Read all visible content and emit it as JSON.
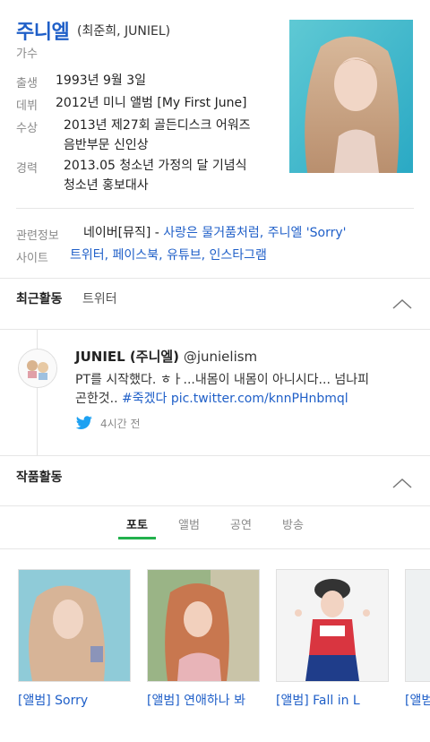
{
  "profile": {
    "name": "주니엘",
    "name_sub": "(최준희, JUNIEL)",
    "occupation": "가수",
    "rows": [
      {
        "label": "출생",
        "value": "1993년 9월 3일"
      },
      {
        "label": "데뷔",
        "value": "2012년 미니 앨범 [My First June]"
      },
      {
        "label": "수상",
        "value": "2013년 제27회 골든디스크 어워즈",
        "value2": "음반부문 신인상"
      },
      {
        "label": "경력",
        "value": "2013.05 청소년 가정의 달 기념식",
        "value2": "청소년 홍보대사"
      }
    ]
  },
  "related": {
    "label": "관련정보",
    "prefix": "네이버[뮤직] - ",
    "links": [
      "사랑은 물거품처럼",
      "주니엘 'Sorry'"
    ],
    "separator": ", "
  },
  "sites": {
    "label": "사이트",
    "links": [
      "트위터",
      "페이스북",
      "유튜브",
      "인스타그램"
    ],
    "separator": ", "
  },
  "recent": {
    "title": "최근활동",
    "tab": "트위터",
    "tweet": {
      "user": "JUNIEL (주니엘)",
      "handle": "@junielism",
      "text1": "PT를 시작했다. ㅎㅏ...내몸이 내몸이 아니시다... 넘나피",
      "text2_plain": "곤한것.. ",
      "text2_link": "#죽겠다 pic.twitter.com/knnPHnbmql",
      "time": "4시간 전"
    }
  },
  "works": {
    "title": "작품활동",
    "tabs": [
      "포토",
      "앨범",
      "공연",
      "방송"
    ],
    "active_tab": 0,
    "photos": [
      {
        "caption": "[앨범] Sorry"
      },
      {
        "caption": "[앨범] 연애하나 봐"
      },
      {
        "caption": "[앨범] Fall in L"
      },
      {
        "caption": "[앨범]"
      }
    ]
  },
  "colors": {
    "accent": "#1f5fc8",
    "tab_underline": "#22b14c",
    "twitter": "#1da1f2"
  }
}
